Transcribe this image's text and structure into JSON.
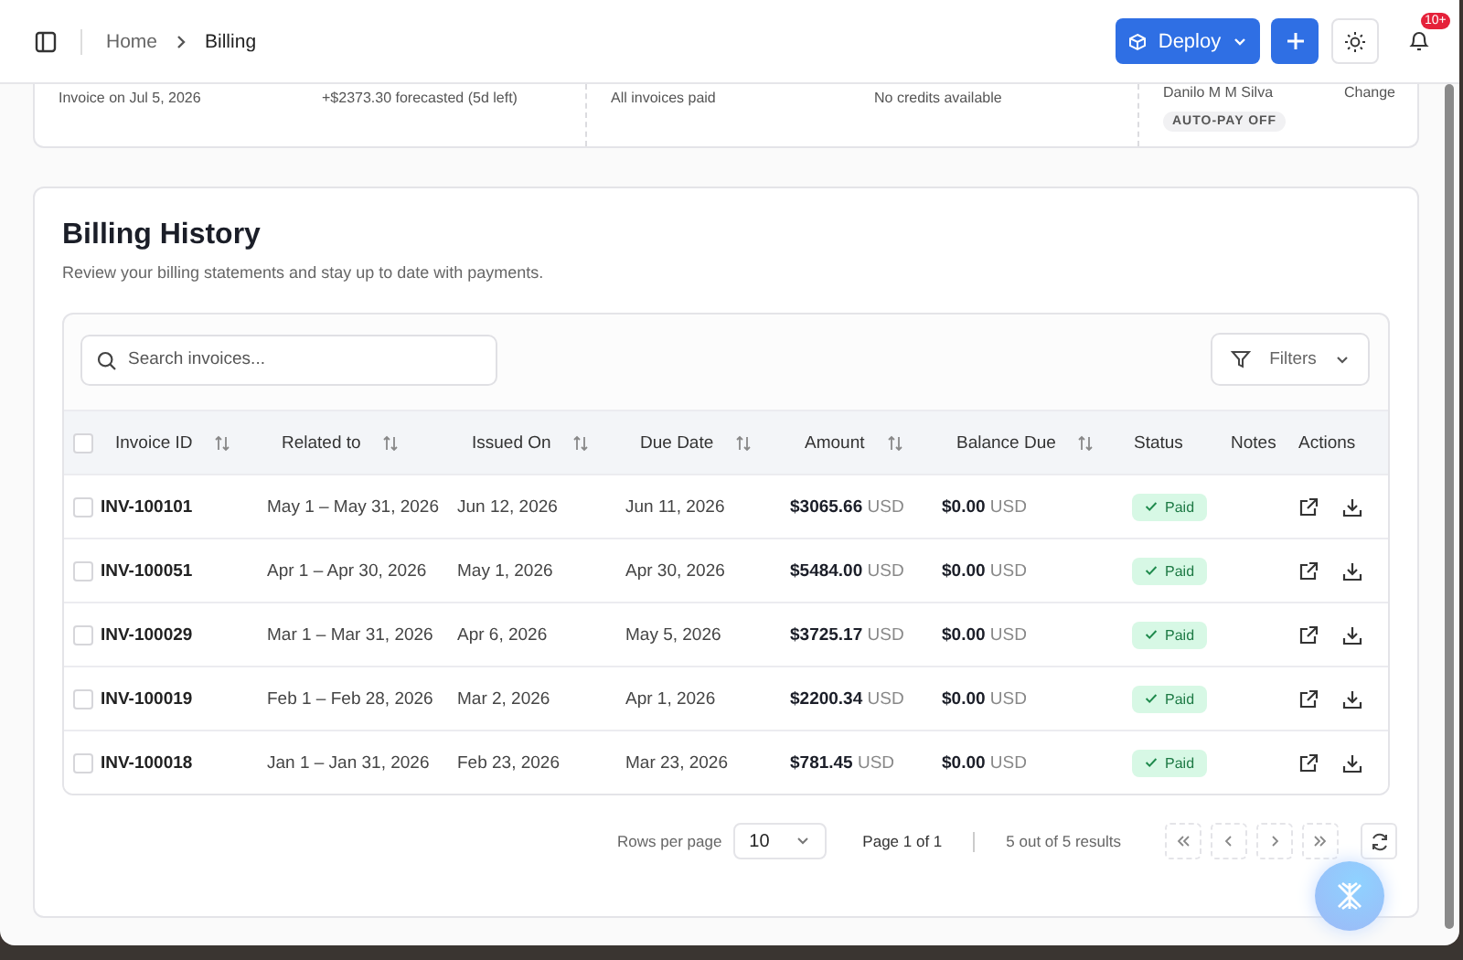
{
  "header": {
    "breadcrumb": [
      "Home",
      "Billing"
    ],
    "deploy_button": "Deploy",
    "notification_count": "10+"
  },
  "summary": {
    "due": [
      "Invoice on Jul 5, 2026",
      "+$2373.30 forecasted (5d left)"
    ],
    "credits": [
      "All invoices paid",
      "No credits available"
    ],
    "owner": "Danilo M M Silva",
    "owner_action": "Change",
    "autopay_badge": "AUTO-PAY OFF"
  },
  "billing_history": {
    "title": "Billing History",
    "subtitle": "Review your billing statements and stay up to date with payments.",
    "search": {
      "placeholder": "Search invoices..."
    },
    "filters_button": "Filters",
    "all_selected": false,
    "columns": [
      {
        "label": "Invoice ID",
        "kind": "sortable"
      },
      {
        "label": "Related to",
        "kind": "sortable"
      },
      {
        "label": "Issued On",
        "kind": "sortable"
      },
      {
        "label": "Due Date",
        "kind": "sortable"
      },
      {
        "label": "Amount",
        "kind": "sortable"
      },
      {
        "label": "Balance Due",
        "kind": "sortable"
      },
      {
        "label": "Status",
        "kind": "plain"
      },
      {
        "label": "Notes",
        "kind": "plain"
      },
      {
        "label": "Actions",
        "kind": "plain"
      }
    ],
    "rows": [
      {
        "selected": false,
        "id": "INV-100101",
        "related": "May 1 – May 31, 2026",
        "issued": "Jun 12, 2026",
        "due": "Jun 11, 2026",
        "amount": "$3065.66",
        "amount_currency": "USD",
        "balance": "$0.00",
        "balance_currency": "USD",
        "status": "Paid"
      },
      {
        "selected": false,
        "id": "INV-100051",
        "related": "Apr 1 – Apr 30, 2026",
        "issued": "May 1, 2026",
        "due": "Apr 30, 2026",
        "amount": "$5484.00",
        "amount_currency": "USD",
        "balance": "$0.00",
        "balance_currency": "USD",
        "status": "Paid"
      },
      {
        "selected": false,
        "id": "INV-100029",
        "related": "Mar 1 – Mar 31, 2026",
        "issued": "Apr 6, 2026",
        "due": "May 5, 2026",
        "amount": "$3725.17",
        "amount_currency": "USD",
        "balance": "$0.00",
        "balance_currency": "USD",
        "status": "Paid"
      },
      {
        "selected": false,
        "id": "INV-100019",
        "related": "Feb 1 – Feb 28, 2026",
        "issued": "Mar 2, 2026",
        "due": "Apr 1, 2026",
        "amount": "$2200.34",
        "amount_currency": "USD",
        "balance": "$0.00",
        "balance_currency": "USD",
        "status": "Paid"
      },
      {
        "selected": false,
        "id": "INV-100018",
        "related": "Jan 1 – Jan 31, 2026",
        "issued": "Feb 23, 2026",
        "due": "Mar 23, 2026",
        "amount": "$781.45",
        "amount_currency": "USD",
        "balance": "$0.00",
        "balance_currency": "USD",
        "status": "Paid"
      }
    ],
    "pagination": {
      "rows_per_page_label": "Rows per page",
      "rows_per_page": "10",
      "page": "Page 1 of 1",
      "results": "5 out of 5 results"
    }
  }
}
